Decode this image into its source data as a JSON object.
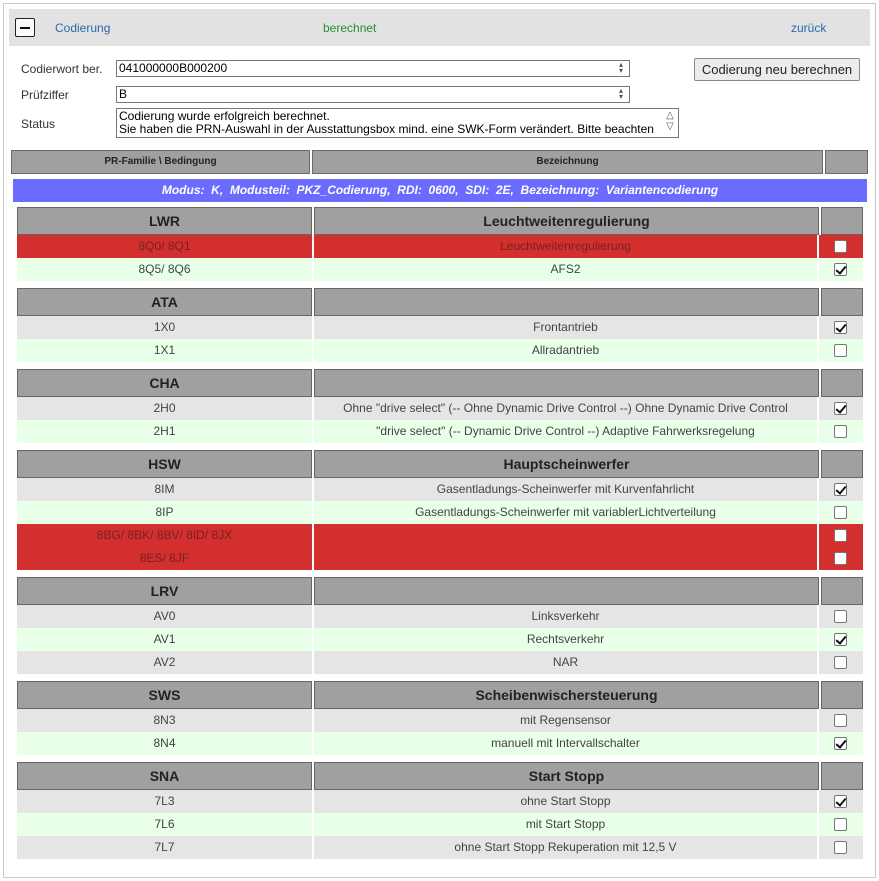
{
  "topbar": {
    "title": "Codierung",
    "status": "berechnet",
    "back": "zurück"
  },
  "form": {
    "codierwort_label": "Codierwort ber.",
    "codierwort_value": "041000000B000200",
    "pruefziffer_label": "Prüfziffer",
    "pruefziffer_value": "B",
    "status_label": "Status",
    "status_line1": "Codierung wurde erfolgreich berechnet.",
    "status_line2": "Sie haben die PRN-Auswahl in der Ausstattungsbox mind. eine SWK-Form verändert. Bitte beachten",
    "recalc_button": "Codierung neu berechnen"
  },
  "table_header": {
    "col1": "PR-Familie \\ Bedingung",
    "col2": "Bezeichnung",
    "col3": ""
  },
  "mode_bar": "Modus:  K,  Modusteil:  PKZ_Codierung,  RDI:  0600,  SDI:  2E,  Bezeichnung:  Variantencodierung",
  "groups": [
    {
      "code": "LWR",
      "name": "Leuchtweitenregulierung",
      "rows": [
        {
          "pr": "8Q0/ 8Q1",
          "desc": "Leuchtweitenregulierung",
          "checked": false,
          "state": "red"
        },
        {
          "pr": "8Q5/ 8Q6",
          "desc": "AFS2",
          "checked": true,
          "state": "green"
        }
      ]
    },
    {
      "code": "ATA",
      "name": "",
      "rows": [
        {
          "pr": "1X0",
          "desc": "Frontantrieb",
          "checked": true,
          "state": "gray"
        },
        {
          "pr": "1X1",
          "desc": "Allradantrieb",
          "checked": false,
          "state": "green"
        }
      ]
    },
    {
      "code": "CHA",
      "name": "",
      "rows": [
        {
          "pr": "2H0",
          "desc": "Ohne \"drive select\" (-- Ohne Dynamic Drive Control --) Ohne Dynamic Drive Control",
          "checked": true,
          "state": "gray"
        },
        {
          "pr": "2H1",
          "desc": "\"drive select\" (-- Dynamic Drive Control --) Adaptive Fahrwerksregelung",
          "checked": false,
          "state": "green"
        }
      ]
    },
    {
      "code": "HSW",
      "name": "Hauptscheinwerfer",
      "rows": [
        {
          "pr": "8IM",
          "desc": "Gasentladungs-Scheinwerfer mit Kurvenfahrlicht",
          "checked": true,
          "state": "gray"
        },
        {
          "pr": "8IP",
          "desc": "Gasentladungs-Scheinwerfer mit variablerLichtverteilung",
          "checked": false,
          "state": "green"
        },
        {
          "pr": "8BG/ 8BK/ 8BV/ 8ID/ 8JX",
          "desc": "",
          "checked": false,
          "state": "red"
        },
        {
          "pr": "8ES/ 8JF",
          "desc": "",
          "checked": false,
          "state": "red"
        }
      ]
    },
    {
      "code": "LRV",
      "name": "",
      "rows": [
        {
          "pr": "AV0",
          "desc": "Linksverkehr",
          "checked": false,
          "state": "gray"
        },
        {
          "pr": "AV1",
          "desc": "Rechtsverkehr",
          "checked": true,
          "state": "green"
        },
        {
          "pr": "AV2",
          "desc": "NAR",
          "checked": false,
          "state": "gray"
        }
      ]
    },
    {
      "code": "SWS",
      "name": "Scheibenwischersteuerung",
      "rows": [
        {
          "pr": "8N3",
          "desc": "mit Regensensor",
          "checked": false,
          "state": "gray"
        },
        {
          "pr": "8N4",
          "desc": "manuell mit Intervallschalter",
          "checked": true,
          "state": "green"
        }
      ]
    },
    {
      "code": "SNA",
      "name": "Start Stopp",
      "rows": [
        {
          "pr": "7L3",
          "desc": "ohne Start Stopp",
          "checked": true,
          "state": "gray"
        },
        {
          "pr": "7L6",
          "desc": "mit Start Stopp",
          "checked": false,
          "state": "green"
        },
        {
          "pr": "7L7",
          "desc": "ohne Start Stopp Rekuperation mit 12,5 V",
          "checked": false,
          "state": "gray"
        }
      ]
    }
  ],
  "colors": {
    "row_gray": "#e5e5e5",
    "row_green": "#e8ffe8",
    "row_red": "#d32f2f",
    "mode_bar": "#6b6bff",
    "header": "#a0a0a0",
    "link": "#2a6aa8",
    "status_ok": "#2e8b2e"
  }
}
